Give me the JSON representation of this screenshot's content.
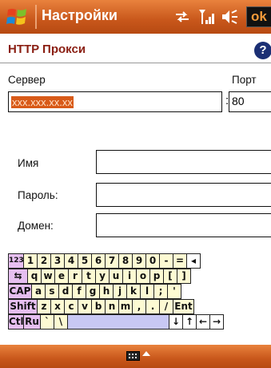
{
  "title_bar": {
    "app_title": "Настройки",
    "ok_label": "ok",
    "icons": [
      "windows-logo",
      "sync-icon",
      "signal-icon",
      "volume-icon"
    ]
  },
  "header": {
    "title": "HTTP Прокси",
    "help_label": "?"
  },
  "form": {
    "server_label": "Сервер",
    "server_value": "xxx.xxx.xx.xx",
    "port_label": "Порт",
    "port_separator": ":",
    "port_value": "80",
    "name_label": "Имя",
    "name_value": "",
    "password_label": "Пароль:",
    "password_value": "",
    "domain_label": "Домен:",
    "domain_value": ""
  },
  "keyboard": {
    "rows": [
      [
        {
          "t": "123",
          "w": 19,
          "c": "lav",
          "s": 1
        },
        {
          "t": "1"
        },
        {
          "t": "2"
        },
        {
          "t": "3"
        },
        {
          "t": "4"
        },
        {
          "t": "5"
        },
        {
          "t": "6"
        },
        {
          "t": "7"
        },
        {
          "t": "8"
        },
        {
          "t": "9"
        },
        {
          "t": "0"
        },
        {
          "t": "-"
        },
        {
          "t": "="
        },
        {
          "t": "◂",
          "c": "wht"
        }
      ],
      [
        {
          "t": "⇆",
          "w": 24,
          "c": "lav"
        },
        {
          "t": "q"
        },
        {
          "t": "w"
        },
        {
          "t": "e"
        },
        {
          "t": "r"
        },
        {
          "t": "t"
        },
        {
          "t": "y"
        },
        {
          "t": "u"
        },
        {
          "t": "i"
        },
        {
          "t": "o"
        },
        {
          "t": "p"
        },
        {
          "t": "["
        },
        {
          "t": "]"
        }
      ],
      [
        {
          "t": "CAP",
          "w": 29,
          "c": "lav"
        },
        {
          "t": "a"
        },
        {
          "t": "s"
        },
        {
          "t": "d"
        },
        {
          "t": "f"
        },
        {
          "t": "g"
        },
        {
          "t": "h"
        },
        {
          "t": "j"
        },
        {
          "t": "k"
        },
        {
          "t": "l"
        },
        {
          "t": ";"
        },
        {
          "t": "'"
        }
      ],
      [
        {
          "t": "Shift",
          "w": 36,
          "c": "lav"
        },
        {
          "t": "z"
        },
        {
          "t": "x"
        },
        {
          "t": "c"
        },
        {
          "t": "v"
        },
        {
          "t": "b"
        },
        {
          "t": "n"
        },
        {
          "t": "m"
        },
        {
          "t": ","
        },
        {
          "t": "."
        },
        {
          "t": "/"
        },
        {
          "t": "Ent",
          "w": 26
        }
      ],
      [
        {
          "t": "Ctl",
          "w": 19,
          "c": "lav"
        },
        {
          "t": "Ru",
          "w": 21,
          "c": "lav"
        },
        {
          "t": "`"
        },
        {
          "t": "\\"
        },
        {
          "t": "",
          "w": 127,
          "c": "spc"
        },
        {
          "t": "↓",
          "c": "wht"
        },
        {
          "t": "↑",
          "c": "wht"
        },
        {
          "t": "←",
          "c": "wht"
        },
        {
          "t": "→",
          "c": "wht"
        }
      ]
    ]
  },
  "bottom_bar": {
    "icons": [
      "keyboard-icon",
      "up-arrow-icon"
    ]
  }
}
